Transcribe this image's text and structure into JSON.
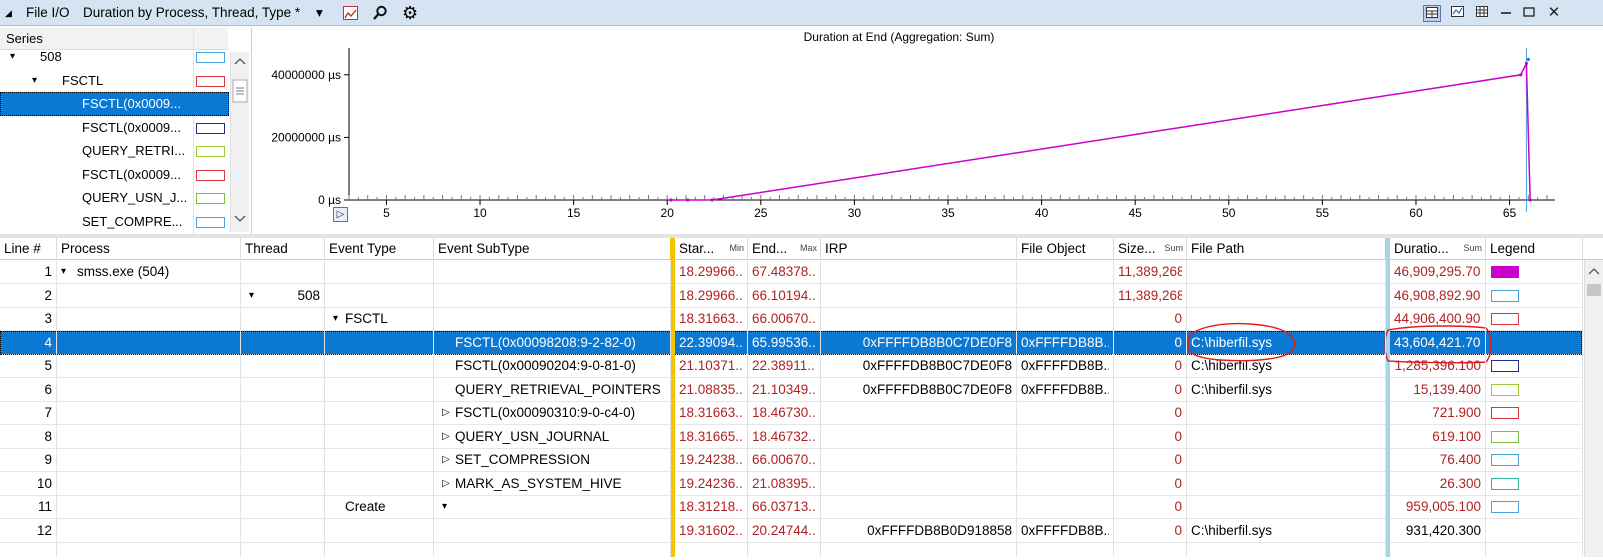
{
  "titlebar": {
    "collapse_glyph": "◢",
    "tab": "File I/O",
    "preset": "Duration by Process, Thread, Type *",
    "preset_dropdown": "▾",
    "right_buttons": [
      "table-graph",
      "graph-only",
      "table-only",
      "minimize",
      "restore",
      "close"
    ]
  },
  "series": {
    "header": "Series",
    "rows": [
      {
        "label": "508",
        "color": "#4aa3df",
        "indent": 40,
        "expander": "▾"
      },
      {
        "label": "FSCTL",
        "color": "#d9363e",
        "indent": 62,
        "expander": "▾"
      },
      {
        "label": "FSCTL(0x0009...",
        "color": "#0b78d4",
        "indent": 82,
        "selected": true
      },
      {
        "label": "FSCTL(0x0009...",
        "color": "#20307a",
        "indent": 82
      },
      {
        "label": "QUERY_RETRI...",
        "color": "#9acd32",
        "indent": 82
      },
      {
        "label": "FSCTL(0x0009...",
        "color": "#d9363e",
        "indent": 82
      },
      {
        "label": "QUERY_USN_J...",
        "color": "#7cbd42",
        "indent": 82
      },
      {
        "label": "SET_COMPRE...",
        "color": "#4aa3df",
        "indent": 82
      }
    ]
  },
  "chart_data": {
    "type": "line",
    "title": "Duration at End (Aggregation: Sum)",
    "y_unit": "µs",
    "y_ticks": [
      0,
      20000000,
      40000000
    ],
    "y_tick_labels": [
      "0 µs",
      "20000000 µs",
      "40000000 µs"
    ],
    "ylim": [
      0,
      46000000
    ],
    "x_ticks": [
      5,
      10,
      15,
      20,
      25,
      30,
      35,
      40,
      45,
      50,
      55,
      60,
      65
    ],
    "xlim": [
      3,
      67
    ],
    "series": [
      {
        "color": "#cc00cc",
        "x": [
          20.2,
          21.1,
          22.4,
          65.6,
          65.9,
          66.1
        ],
        "y": [
          0,
          0,
          0,
          40000000,
          43604421.7,
          0
        ]
      },
      {
        "color": "#0b78d4",
        "x": [
          66.0
        ],
        "y": [
          44906400.9
        ]
      }
    ],
    "cursor_x": 65.9,
    "legend": "none",
    "grid": false
  },
  "table": {
    "headers": [
      {
        "label": "Line #"
      },
      {
        "label": "Process"
      },
      {
        "label": "Thread"
      },
      {
        "label": "Event Type"
      },
      {
        "label": "Event SubType"
      },
      {
        "label": "Star...",
        "sub": "Min"
      },
      {
        "label": "End...",
        "sub": "Max"
      },
      {
        "label": "IRP"
      },
      {
        "label": "File Object"
      },
      {
        "label": "Size...",
        "sub": "Sum"
      },
      {
        "label": "File Path"
      },
      {
        "label": "Duratio...",
        "sub": "Sum"
      },
      {
        "label": "Legend"
      }
    ],
    "rows": [
      {
        "line": "1",
        "process": "smss.exe (504)",
        "proc_exp": "▾",
        "thread": "",
        "thread_exp": "",
        "etype": "",
        "etype_exp": "",
        "subtype": "",
        "sub_exp": "",
        "start": "18.29966...",
        "end": "67.48378...",
        "irp": "",
        "fileobj": "",
        "size": "11,389,268",
        "path": "",
        "duration": "46,909,295.700",
        "dur_red": true,
        "legend_color": "#cc00cc",
        "legend_fill": true
      },
      {
        "line": "2",
        "process": "",
        "proc_exp": "",
        "thread": "508",
        "thread_exp": "▾",
        "etype": "",
        "etype_exp": "",
        "subtype": "",
        "sub_exp": "",
        "start": "18.29966...",
        "end": "66.10194...",
        "irp": "",
        "fileobj": "",
        "size": "11,389,268",
        "path": "",
        "duration": "46,908,892.900",
        "dur_red": true,
        "legend_color": "#4aa3df"
      },
      {
        "line": "3",
        "process": "",
        "proc_exp": "",
        "thread": "",
        "thread_exp": "",
        "etype": "FSCTL",
        "etype_exp": "▾",
        "subtype": "",
        "sub_exp": "",
        "start": "18.31663...",
        "end": "66.00670...",
        "irp": "",
        "fileobj": "",
        "size": "0",
        "path": "",
        "duration": "44,906,400.900",
        "dur_red": true,
        "legend_color": "#d9363e"
      },
      {
        "line": "4",
        "process": "",
        "proc_exp": "",
        "thread": "",
        "thread_exp": "",
        "etype": "",
        "etype_exp": "",
        "subtype": "FSCTL(0x00098208:9-2-82-0)",
        "sub_exp": "",
        "start": "22.39094...",
        "end": "65.99536...",
        "irp": "0xFFFFDB8B0C7DE0F8",
        "fileobj": "0xFFFFDB8B...",
        "size": "0",
        "path": "C:\\hiberfil.sys",
        "duration": "43,604,421.700",
        "dur_red": true,
        "legend_color": "#0b78d4",
        "selected": true
      },
      {
        "line": "5",
        "process": "",
        "proc_exp": "",
        "thread": "",
        "thread_exp": "",
        "etype": "",
        "etype_exp": "",
        "subtype": "FSCTL(0x00090204:9-0-81-0)",
        "sub_exp": "",
        "start": "21.10371...",
        "end": "22.38911...",
        "irp": "0xFFFFDB8B0C7DE0F8",
        "fileobj": "0xFFFFDB8B...",
        "size": "0",
        "path": "C:\\hiberfil.sys",
        "duration": "1,285,396.100",
        "dur_red": true,
        "legend_color": "#20307a"
      },
      {
        "line": "6",
        "process": "",
        "proc_exp": "",
        "thread": "",
        "thread_exp": "",
        "etype": "",
        "etype_exp": "",
        "subtype": "QUERY_RETRIEVAL_POINTERS",
        "sub_exp": "",
        "start": "21.08835...",
        "end": "21.10349...",
        "irp": "0xFFFFDB8B0C7DE0F8",
        "fileobj": "0xFFFFDB8B...",
        "size": "0",
        "path": "C:\\hiberfil.sys",
        "duration": "15,139.400",
        "dur_red": true,
        "legend_color": "#9acd32"
      },
      {
        "line": "7",
        "process": "",
        "proc_exp": "",
        "thread": "",
        "thread_exp": "",
        "etype": "",
        "etype_exp": "",
        "subtype": "FSCTL(0x00090310:9-0-c4-0)",
        "sub_exp": "▷",
        "start": "18.31663...",
        "end": "18.46730...",
        "irp": "",
        "fileobj": "",
        "size": "0",
        "path": "",
        "duration": "721.900",
        "dur_red": true,
        "legend_color": "#d9363e"
      },
      {
        "line": "8",
        "process": "",
        "proc_exp": "",
        "thread": "",
        "thread_exp": "",
        "etype": "",
        "etype_exp": "",
        "subtype": "QUERY_USN_JOURNAL",
        "sub_exp": "▷",
        "start": "18.31665...",
        "end": "18.46732...",
        "irp": "",
        "fileobj": "",
        "size": "0",
        "path": "",
        "duration": "619.100",
        "dur_red": true,
        "legend_color": "#7cbd42"
      },
      {
        "line": "9",
        "process": "",
        "proc_exp": "",
        "thread": "",
        "thread_exp": "",
        "etype": "",
        "etype_exp": "",
        "subtype": "SET_COMPRESSION",
        "sub_exp": "▷",
        "start": "19.24238...",
        "end": "66.00670...",
        "irp": "",
        "fileobj": "",
        "size": "0",
        "path": "",
        "duration": "76.400",
        "dur_red": true,
        "legend_color": "#4aa3df"
      },
      {
        "line": "10",
        "process": "",
        "proc_exp": "",
        "thread": "",
        "thread_exp": "",
        "etype": "",
        "etype_exp": "",
        "subtype": "MARK_AS_SYSTEM_HIVE",
        "sub_exp": "▷",
        "start": "19.24236...",
        "end": "21.08395...",
        "irp": "",
        "fileobj": "",
        "size": "0",
        "path": "",
        "duration": "26.300",
        "dur_red": true,
        "legend_color": "#2fb5a0"
      },
      {
        "line": "11",
        "process": "",
        "proc_exp": "",
        "thread": "",
        "thread_exp": "",
        "etype": "Create",
        "etype_exp": "",
        "subtype": "",
        "sub_exp": "▾",
        "start": "18.31218...",
        "end": "66.03713...",
        "irp": "",
        "fileobj": "",
        "size": "0",
        "path": "",
        "duration": "959,005.100",
        "dur_red": true,
        "legend_color": "#4aa3df"
      },
      {
        "line": "12",
        "process": "",
        "proc_exp": "",
        "thread": "",
        "thread_exp": "",
        "etype": "",
        "etype_exp": "",
        "subtype": "",
        "sub_exp": "",
        "start": "19.31602...",
        "end": "20.24744...",
        "irp": "0xFFFFDB8B0D918858",
        "fileobj": "0xFFFFDB8B...",
        "size": "0",
        "path": "C:\\hiberfil.sys",
        "duration": "931,420.300",
        "dur_red": false,
        "legend_color": ""
      }
    ]
  },
  "annotations": [
    {
      "kind": "hand-drawn-circle",
      "color": "#e01b1b",
      "target": "row-4-file-path"
    },
    {
      "kind": "hand-drawn-circle",
      "color": "#e01b1b",
      "target": "row-4-duration"
    }
  ]
}
